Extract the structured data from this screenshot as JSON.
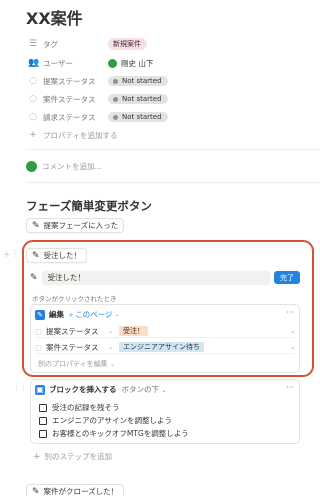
{
  "page": {
    "title": "XX案件"
  },
  "properties": [
    {
      "icon": "list-icon",
      "label": "タグ",
      "value_type": "tag",
      "value": "新規案件"
    },
    {
      "icon": "user-icon",
      "label": "ユーザー",
      "value_type": "user",
      "value": "剛史 山下"
    },
    {
      "icon": "status-icon",
      "label": "提案ステータス",
      "value_type": "status",
      "value": "Not started"
    },
    {
      "icon": "status-icon",
      "label": "案件ステータス",
      "value_type": "status",
      "value": "Not started"
    },
    {
      "icon": "status-icon",
      "label": "請求ステータス",
      "value_type": "status",
      "value": "Not started"
    }
  ],
  "add_property": "プロパティを追加する",
  "comment_placeholder": "コメントを追加...",
  "section_heading": "フェーズ簡単変更ボタン",
  "buttons": {
    "proposal_phase": "提案フェーズに入った",
    "order_received": "受注した！",
    "case_closed": "案件がクローズした！"
  },
  "editor": {
    "name_value": "受注した！",
    "done_label": "完了",
    "when_clicked": "ボタンがクリックされたとき",
    "edit_action": {
      "label": "編集",
      "target": "このページ",
      "rows": [
        {
          "property": "提案ステータス",
          "value": "受注！"
        },
        {
          "property": "案件ステータス",
          "value": "エンジニアアサイン待ち"
        }
      ],
      "edit_other": "別のプロパティを編集"
    },
    "insert_block": {
      "label": "ブロックを挿入する",
      "position": "ボタンの下",
      "items": [
        "受注の記録を残そう",
        "エンジニアのアサインを調整しよう",
        "お客様とのキックオフMTGを調整しよう"
      ]
    },
    "add_step": "別のステップを追加"
  },
  "colors": {
    "highlight_border": "#d4532e",
    "tag_bg": "#f5e0e9",
    "tag_text": "#4c2337",
    "status_bg": "#e3e2e0",
    "status_dot": "#91918e",
    "done_bg": "#2383e2",
    "value_orange_bg": "#fadec9",
    "value_blue_bg": "#d3e5ef",
    "avatar_green": "#2e9e44"
  }
}
